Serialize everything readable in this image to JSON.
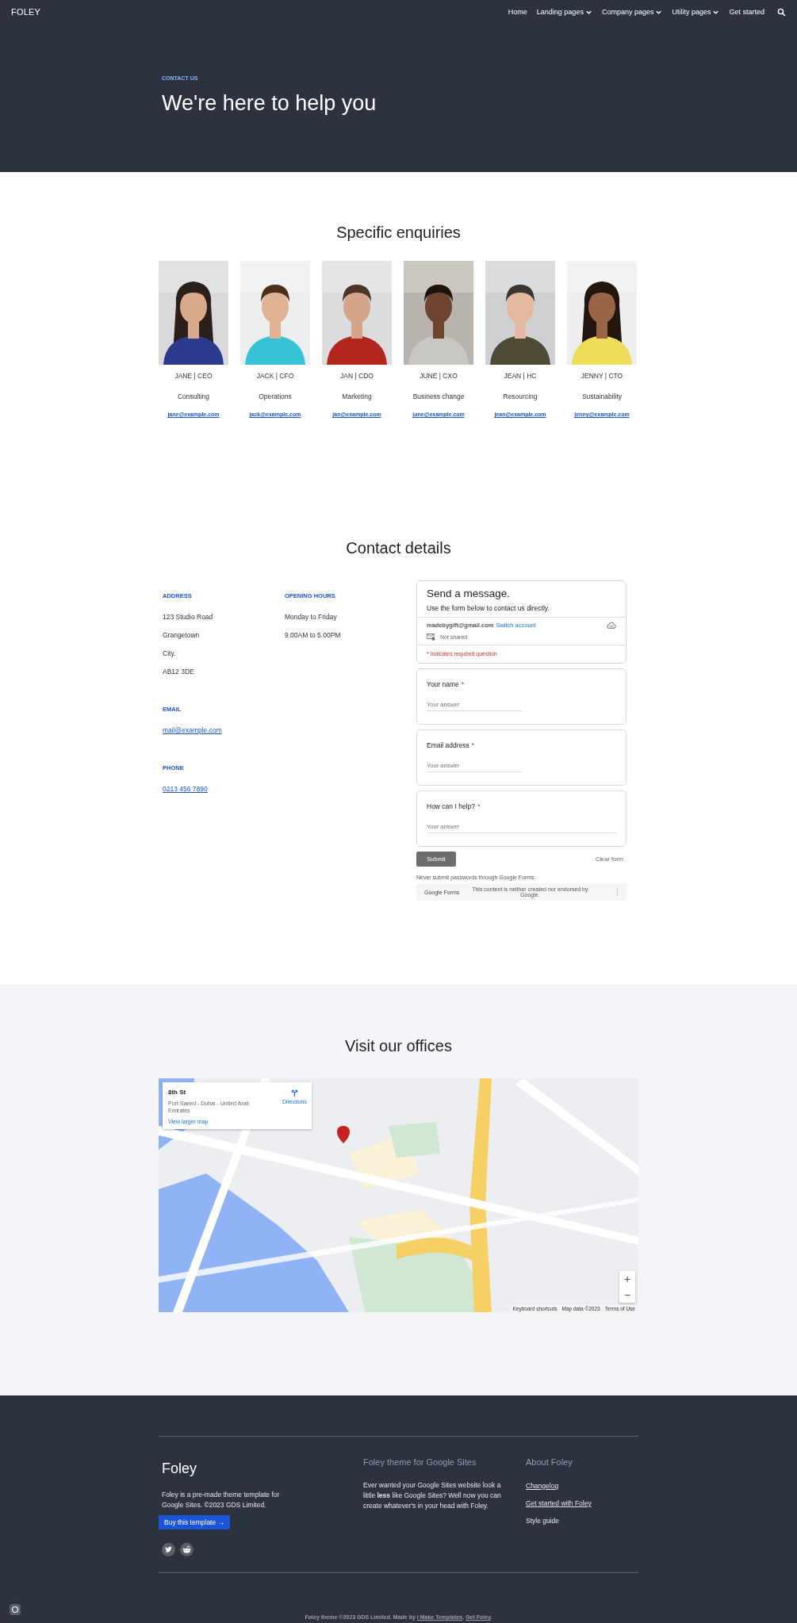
{
  "nav": {
    "brand": "FOLEY",
    "items": [
      {
        "label": "Home",
        "dropdown": false
      },
      {
        "label": "Landing pages",
        "dropdown": true
      },
      {
        "label": "Company pages",
        "dropdown": true
      },
      {
        "label": "Utility pages",
        "dropdown": true
      },
      {
        "label": "Get started",
        "dropdown": false
      }
    ]
  },
  "hero": {
    "eyebrow": "CONTACT US",
    "title": "We're here to help you"
  },
  "enquiries": {
    "title": "Specific enquiries",
    "people": [
      {
        "name": "JANE | CEO",
        "area": "Consulting",
        "email": "jane@example.com"
      },
      {
        "name": "JACK | CFO",
        "area": "Operations",
        "email": "jack@example.com"
      },
      {
        "name": "JAN | CDO",
        "area": "Marketing",
        "email": "jan@example.com"
      },
      {
        "name": "JUNE | CXO",
        "area": "Business change",
        "email": "june@example.com"
      },
      {
        "name": "JEAN | HC",
        "area": "Resourcing",
        "email": "jean@example.com"
      },
      {
        "name": "JENNY | CTO",
        "area": "Sustainability",
        "email": "jenny@example.com"
      }
    ]
  },
  "contact": {
    "title": "Contact details",
    "address": {
      "label": "ADDRESS",
      "lines": [
        "123 Studio Road",
        "Grangetown",
        "City.",
        "AB12 3DE"
      ]
    },
    "hours": {
      "label": "OPENING HOURS",
      "lines": [
        "Monday to Friday",
        "9.00AM to 5.00PM"
      ]
    },
    "email": {
      "label": "EMAIL",
      "value": "mail@example.com"
    },
    "phone": {
      "label": "PHONE",
      "value": "0213 456 7890"
    },
    "form": {
      "title": "Send a message.",
      "description": "Use the form below to contact us directly.",
      "account": "madebygift@gmail.com",
      "switch_account": "Switch account",
      "not_shared": "Not shared",
      "required_note": "* Indicates required question",
      "required_mark": "*",
      "questions": [
        {
          "label": "Your name",
          "required": true,
          "placeholder": "Your answer",
          "wide": false
        },
        {
          "label": "Email address",
          "required": true,
          "placeholder": "Your answer",
          "wide": false
        },
        {
          "label": "How can I help?",
          "required": true,
          "placeholder": "Your answer",
          "wide": true
        }
      ],
      "submit": "Submit",
      "clear": "Clear form",
      "warning": "Never submit passwords through Google Forms.",
      "brand": "Google Forms",
      "disclaimer": "This content is neither created nor endorsed by Google."
    }
  },
  "offices": {
    "title": "Visit our offices",
    "map": {
      "card": {
        "place": "8th St",
        "address": "Port Saeed - Dubai - United Arab Emirates",
        "directions": "Directions",
        "larger_map": "View larger map"
      },
      "zoom_in": "+",
      "zoom_out": "−",
      "attribution": [
        "Keyboard shortcuts",
        "Map data ©2023",
        "Terms of Use"
      ]
    }
  },
  "footer": {
    "brand": "Foley",
    "about": "Foley is a pre-made theme template for Google Sites. ©2023 GDS Limited.",
    "buy": "Buy this template →",
    "theme_title": "Foley theme for Google Sites",
    "theme_text": "Ever wanted your Google Sites website look a little **less** like Google Sites? Well now you can create whatever's in your head with Foley.",
    "about_title": "About Foley",
    "links": [
      {
        "label": "Changelog",
        "underlined": true
      },
      {
        "label": "Get started with Foley",
        "underlined": true
      },
      {
        "label": "Style guide",
        "underlined": false
      }
    ],
    "credit": {
      "text": "Foley theme ©2023 GDS Limited. Made by",
      "maker": "I Make Templates",
      "separator": ".",
      "get": "Get Foley",
      "end": "."
    }
  }
}
